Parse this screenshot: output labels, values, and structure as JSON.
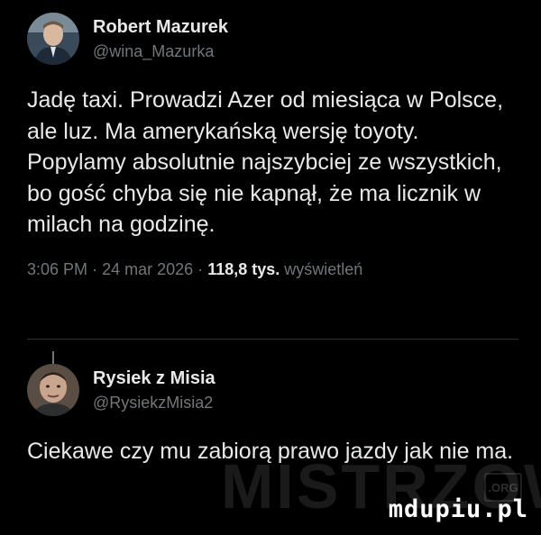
{
  "tweet1": {
    "display_name": "Robert Mazurek",
    "handle": "@wina_Mazurka",
    "text": "Jadę taxi. Prowadzi Azer od miesiąca w Polsce, ale luz. Ma amerykańską wersję toyoty. Popylamy absolutnie najszybciej ze wszystkich, bo gość chyba się nie kapnął, że ma licznik w milach na godzinę.",
    "time": "3:06 PM",
    "date": "24 mar 2026",
    "views_count": "118,8 tys.",
    "views_label": "wyświetleń",
    "separator": "·"
  },
  "tweet2": {
    "display_name": "Rysiek z Misia",
    "handle": "@RysiekzMisia2",
    "text": "Ciekawe czy mu zabiorą prawo jazdy jak nie ma."
  },
  "watermark": {
    "text": "MISTRZOWIE",
    "badge": ".ORG",
    "site": "mdupiu.pl"
  },
  "colors": {
    "background": "#000000",
    "primary_text": "#e7e9ea",
    "secondary_text": "#71767b",
    "divider": "#2f3336"
  },
  "icons": [
    "avatar-robert-mazurek",
    "avatar-rysiek-z-misia"
  ]
}
